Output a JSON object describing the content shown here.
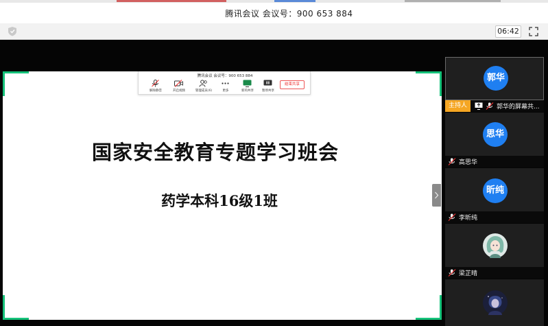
{
  "window": {
    "title": "腾讯会议 会议号：900 653 884"
  },
  "subbar": {
    "timer": "06:42"
  },
  "share_toolbar": {
    "meeting_id": "腾讯会议  会议号：900 653 884",
    "items": [
      {
        "label": "解除静音",
        "icon": "mic-muted-icon"
      },
      {
        "label": "开启视频",
        "icon": "camera-off-icon"
      },
      {
        "label": "管理成员(6)",
        "icon": "members-icon"
      },
      {
        "label": "更多",
        "icon": "more-icon"
      },
      {
        "label": "新的共享",
        "icon": "new-share-icon"
      },
      {
        "label": "暂停共享",
        "icon": "pause-share-icon"
      }
    ],
    "stop_share": "结束共享"
  },
  "slide": {
    "title": "国家安全教育专题学习班会",
    "subtitle": "药学本科16级1班"
  },
  "participants": [
    {
      "avatar_text": "郭华",
      "name": "郭华的屏幕共...",
      "role": "主持人",
      "sharing": true
    },
    {
      "avatar_text": "思华",
      "name": "高思华"
    },
    {
      "avatar_text": "昕纯",
      "name": "李昕纯"
    },
    {
      "avatar_text": "",
      "name": "梁芷晴",
      "avatar_type": "photo"
    },
    {
      "avatar_text": "",
      "name": "",
      "avatar_type": "photo"
    }
  ],
  "colors": {
    "accent_green": "#15c27a",
    "avatar_blue": "#1f7ff1",
    "host_badge": "#f5a623",
    "stop_red": "#e33333"
  }
}
